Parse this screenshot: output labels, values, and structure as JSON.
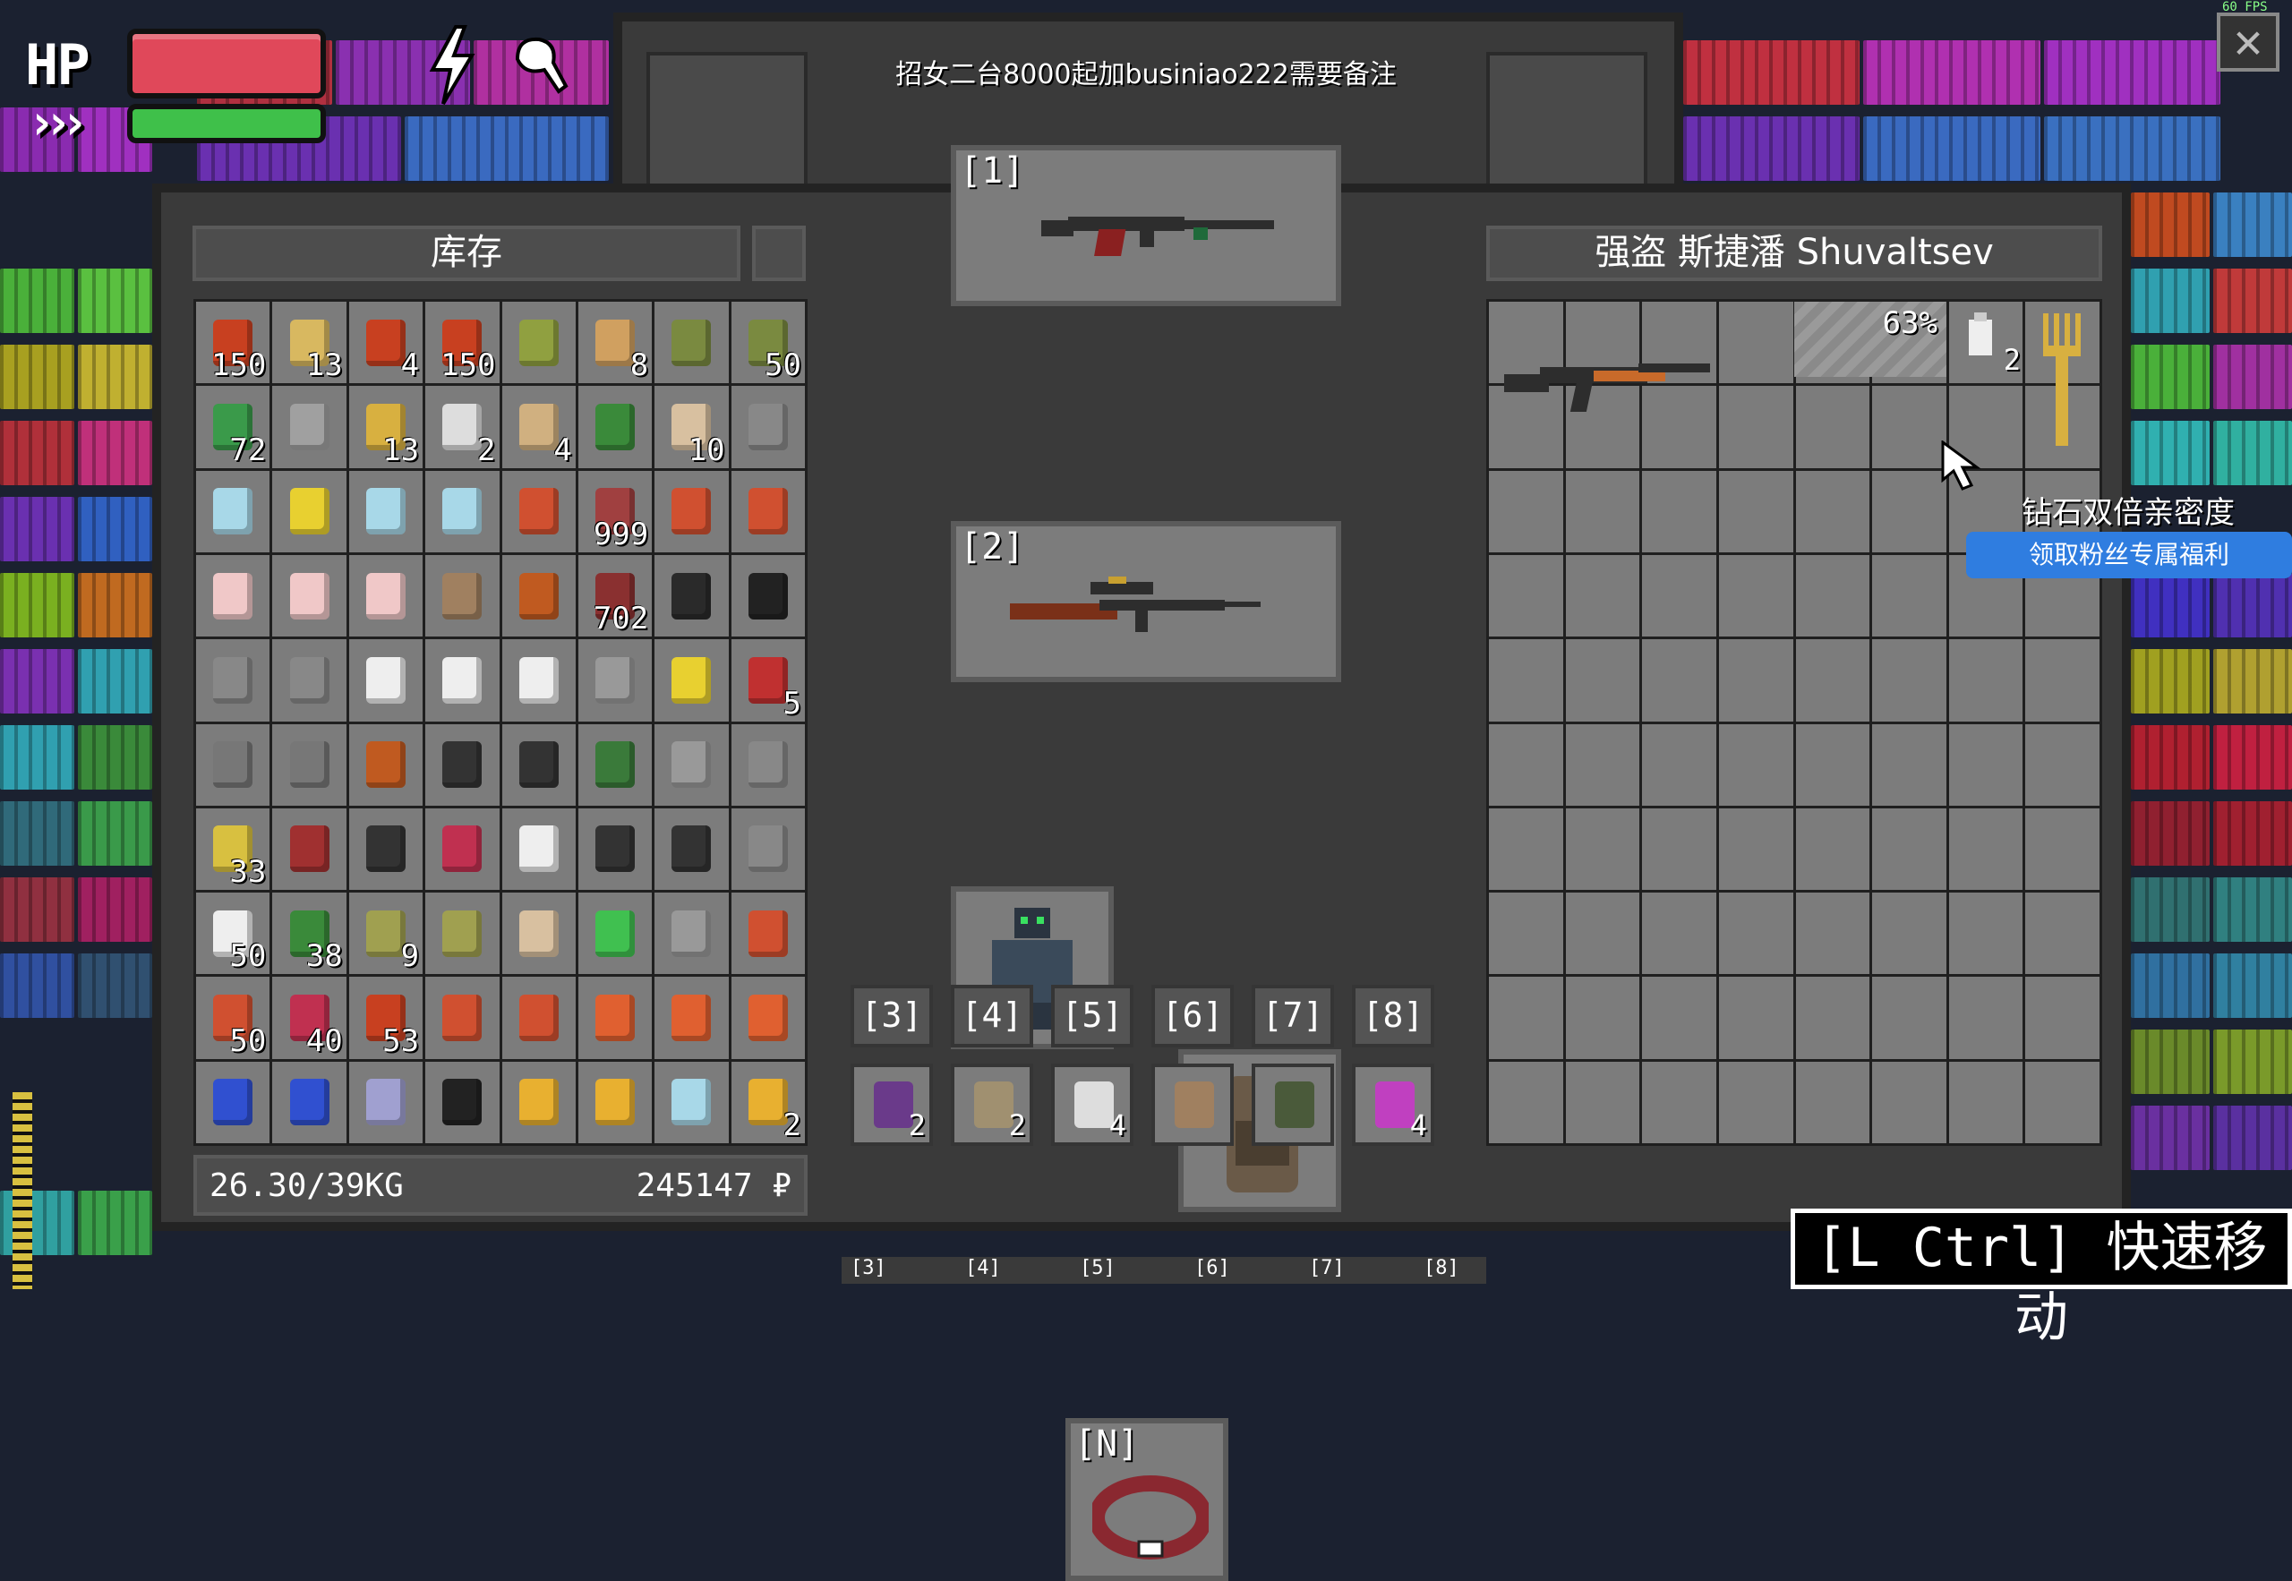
{
  "hud": {
    "hp_label": "HP",
    "sprint_label": "›››",
    "hp_fraction": 1.0,
    "stamina_fraction": 1.0,
    "fps": "60 FPS"
  },
  "announcement": "招女二台8000起加businiao222需要备注",
  "inventory": {
    "title": "库存",
    "weight": "26.30/39KG",
    "money": "245147 ₽",
    "counts": [
      "150",
      "13",
      "4",
      "150",
      "8",
      "50",
      "72",
      "13",
      "2",
      "4",
      "10",
      "999",
      "702",
      "5",
      "33",
      "50",
      "38",
      "9",
      "50",
      "40",
      "53",
      "2"
    ]
  },
  "equipment": {
    "slot1": "[1]",
    "slot2": "[2]",
    "slotN": "[N]"
  },
  "hotbar": {
    "labels": [
      "[3]",
      "[4]",
      "[5]",
      "[6]",
      "[7]",
      "[8]"
    ],
    "counts": [
      "2",
      "2",
      "4",
      "",
      "",
      "4"
    ]
  },
  "loot": {
    "title": "强盗 斯捷潘 Shuvaltsev",
    "durability": "63%",
    "item_count": "2"
  },
  "ads": {
    "line1": "钻石双倍亲密度",
    "button": "领取粉丝专属福利"
  },
  "quickmove": "[L Ctrl] 快速移动",
  "bottom_tabs": [
    "[3]",
    "[4]",
    "[5]",
    "[6]",
    "[7]",
    "[8]"
  ],
  "colors": {
    "hp": "#e0485a",
    "stamina": "#3fc04a",
    "panel": "#3a3a3a",
    "slot": "#7c7c7c",
    "accent_button": "#2f7de0"
  }
}
